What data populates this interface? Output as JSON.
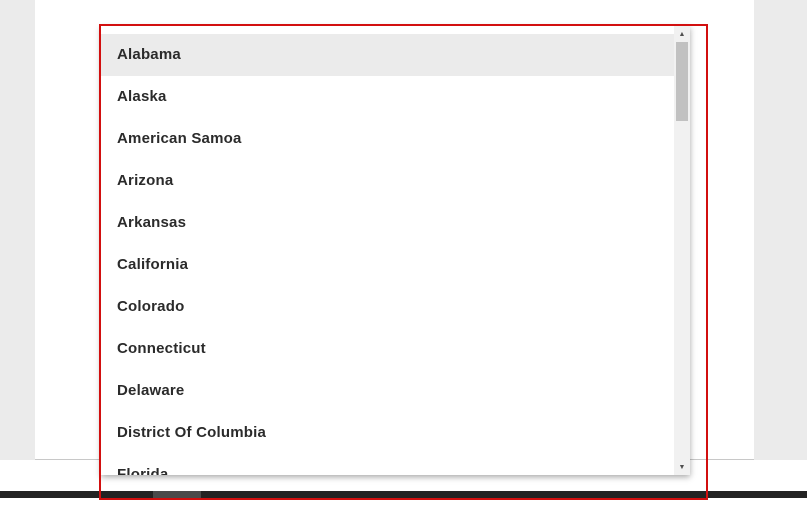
{
  "dropdown": {
    "selected_index": 0,
    "options": [
      "Alabama",
      "Alaska",
      "American Samoa",
      "Arizona",
      "Arkansas",
      "California",
      "Colorado",
      "Connecticut",
      "Delaware",
      "District Of Columbia",
      "Florida"
    ],
    "scroll_position": 0.0
  },
  "scrollbar": {
    "up_icon": "triangle-up-icon",
    "down_icon": "triangle-down-icon"
  },
  "colors": {
    "highlight_frame": "#d20f0f",
    "selected_row": "#ebebeb",
    "text": "#2b2b2b"
  }
}
